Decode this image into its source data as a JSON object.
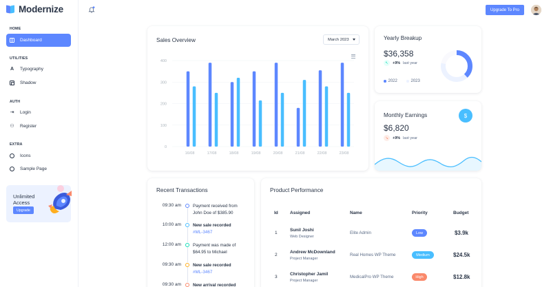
{
  "app": {
    "name": "Modernize"
  },
  "colors": {
    "primary": "#5d87ff",
    "secondary": "#49beff",
    "success": "#13deb9",
    "warning": "#ffae1f",
    "error": "#fa896b",
    "text": "#2a3547"
  },
  "sidebar": {
    "sections": [
      {
        "caption": "HOME",
        "items": [
          {
            "label": "Dashboard",
            "icon": "dashboard-grid-icon",
            "active": true
          }
        ]
      },
      {
        "caption": "UTILITIES",
        "items": [
          {
            "label": "Typography",
            "icon": "typography-icon"
          },
          {
            "label": "Shadow",
            "icon": "copy-icon"
          }
        ]
      },
      {
        "caption": "AUTH",
        "items": [
          {
            "label": "Login",
            "icon": "login-icon"
          },
          {
            "label": "Register",
            "icon": "user-plus-icon"
          }
        ]
      },
      {
        "caption": "EXTRA",
        "items": [
          {
            "label": "Icons",
            "icon": "mood-happy-icon"
          },
          {
            "label": "Sample Page",
            "icon": "aperture-icon"
          }
        ]
      }
    ],
    "promo": {
      "title": "Unlimited Access",
      "button": "Upgrade"
    }
  },
  "header": {
    "upgrade_label": "Upgrade To Pro"
  },
  "sales_overview": {
    "title": "Sales Overview",
    "month": "March 2023",
    "chart_data": {
      "type": "bar",
      "categories": [
        "16/08",
        "17/08",
        "18/08",
        "19/08",
        "20/08",
        "21/08",
        "22/08",
        "23/08"
      ],
      "series": [
        {
          "name": "",
          "values": [
            350,
            390,
            300,
            350,
            390,
            180,
            355,
            390
          ],
          "color": "#5d87ff"
        },
        {
          "name": "",
          "values": [
            280,
            250,
            320,
            215,
            250,
            310,
            280,
            250
          ],
          "color": "#49beff"
        }
      ],
      "ylim": [
        0,
        400
      ],
      "yticks": [
        0,
        100,
        200,
        300,
        400
      ],
      "grid": true
    }
  },
  "yearly_breakup": {
    "title": "Yearly Breakup",
    "amount": "$36,358",
    "change": "+9%",
    "change_label": "last year",
    "legend": [
      "2022",
      "2023"
    ],
    "donut": {
      "values": [
        38,
        40,
        22
      ],
      "colors": [
        "#5d87ff",
        "#ecf2ff",
        "#f9f9fd"
      ]
    }
  },
  "monthly_earnings": {
    "title": "Monthly Earnings",
    "amount": "$6,820",
    "change": "+9%",
    "change_label": "last year"
  },
  "recent_transactions": {
    "title": "Recent Transactions",
    "items": [
      {
        "time": "09:30 am",
        "text": "Payment received from John Doe of $385.90",
        "bold": false,
        "link": "",
        "color": "#5d87ff"
      },
      {
        "time": "10:00 am",
        "text": "New sale recorded",
        "bold": true,
        "link": "#ML-3467",
        "color": "#49beff"
      },
      {
        "time": "12:00 am",
        "text": "Payment was made of $64.95 to Michael",
        "bold": false,
        "link": "",
        "color": "#13deb9"
      },
      {
        "time": "09:30 am",
        "text": "New sale recorded",
        "bold": true,
        "link": "#ML-3467",
        "color": "#ffae1f"
      },
      {
        "time": "09:30 am",
        "text": "New arrival recorded",
        "bold": true,
        "link": "",
        "color": "#fa896b"
      }
    ]
  },
  "product_performance": {
    "title": "Product Performance",
    "columns": [
      "Id",
      "Assigned",
      "Name",
      "Priority",
      "Budget"
    ],
    "rows": [
      {
        "id": "1",
        "assigned": "Sunil Joshi",
        "role": "Web Designer",
        "name": "Elite Admin",
        "priority": "Low",
        "priority_color": "#5d87ff",
        "budget": "$3.9k"
      },
      {
        "id": "2",
        "assigned": "Andrew McDownland",
        "role": "Project Manager",
        "name": "Real Homes WP Theme",
        "priority": "Medium",
        "priority_color": "#49beff",
        "budget": "$24.5k"
      },
      {
        "id": "3",
        "assigned": "Christopher Jamil",
        "role": "Project Manager",
        "name": "MedicalPro WP Theme",
        "priority": "High",
        "priority_color": "#fa896b",
        "budget": "$12.8k"
      }
    ]
  }
}
